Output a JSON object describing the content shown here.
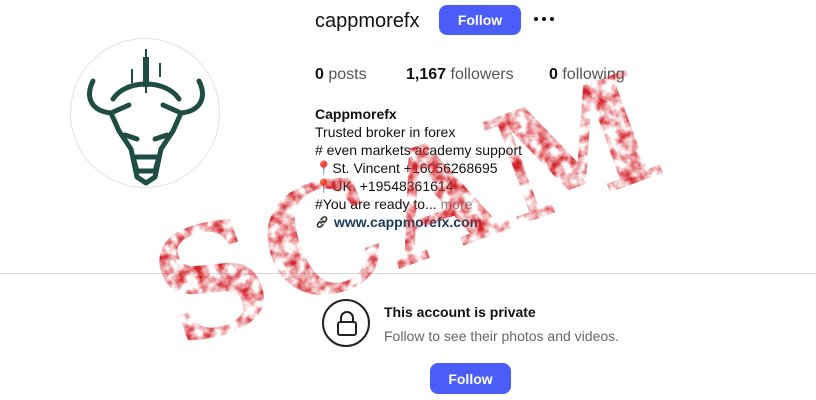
{
  "profile": {
    "username": "cappmorefx",
    "follow_label": "Follow",
    "more_icon": "more-horizontal-icon",
    "avatar_icon": "bull-candlestick-logo"
  },
  "stats": {
    "posts_count": "0",
    "posts_label": "posts",
    "followers_count": "1,167",
    "followers_label": "followers",
    "following_count": "0",
    "following_label": "following"
  },
  "bio": {
    "name": "Cappmorefx",
    "line1": "Trusted broker in forex",
    "line2": "# even markets academy support",
    "line3": "📍St. Vincent +16056268695",
    "line4": "📍UK. +19548361614",
    "line5": "#You are ready to... ",
    "more_label": "more",
    "link_text": "www.cappmorefx.com",
    "link_icon": "link-icon"
  },
  "private_notice": {
    "title": "This account is private",
    "subtitle": "Follow to see their photos and videos.",
    "lock_icon": "lock-icon",
    "follow_label": "Follow"
  },
  "overlay": {
    "stamp_text": "SCAM",
    "stamp_color": "#d4232a"
  },
  "colors": {
    "accent": "#4a5df9",
    "logo": "#1f4d43"
  }
}
